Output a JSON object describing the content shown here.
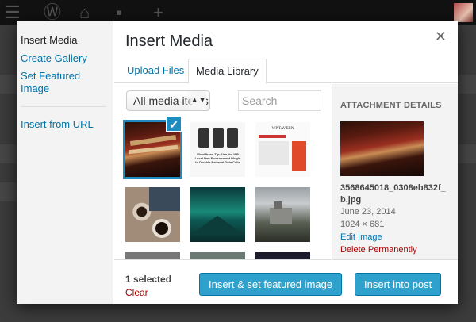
{
  "modal": {
    "title": "Insert Media",
    "close_glyph": "✕"
  },
  "menu": {
    "items": [
      {
        "label": "Insert Media"
      },
      {
        "label": "Create Gallery"
      },
      {
        "label": "Set Featured Image"
      },
      {
        "label": "Insert from URL"
      }
    ]
  },
  "tabs": [
    {
      "label": "Upload Files"
    },
    {
      "label": "Media Library"
    }
  ],
  "filter": {
    "selected": "All media items",
    "caret": "▲▼"
  },
  "search": {
    "placeholder": "Search"
  },
  "grid": {
    "check_glyph": "✔",
    "items": [
      {
        "name": "books-thumbnail",
        "selected": true
      },
      {
        "name": "wp-plugin-article-thumbnail",
        "selected": false,
        "caption": "WordPress Tip: Use the WP Local Dev Environment Plugin to Disable External Data Calls"
      },
      {
        "name": "wp-tavern-thumbnail",
        "selected": false,
        "caption": "WP TAVERN"
      },
      {
        "name": "coffee-thumbnail",
        "selected": false
      },
      {
        "name": "aurora-thumbnail",
        "selected": false
      },
      {
        "name": "castle-thumbnail",
        "selected": false
      }
    ]
  },
  "attachment": {
    "heading": "ATTACHMENT DETAILS",
    "filename": "3568645018_0308eb832f_b.jpg",
    "date": "June 23, 2014",
    "dimensions": "1024 × 681",
    "edit_label": "Edit Image",
    "delete_label": "Delete Permanently"
  },
  "toolbar": {
    "selected_count": "1 selected",
    "clear_label": "Clear",
    "featured_button": "Insert & set featured image",
    "insert_button": "Insert into post"
  },
  "colors": {
    "accent": "#2ea2cc",
    "link": "#0073aa",
    "danger": "#aa0000"
  }
}
